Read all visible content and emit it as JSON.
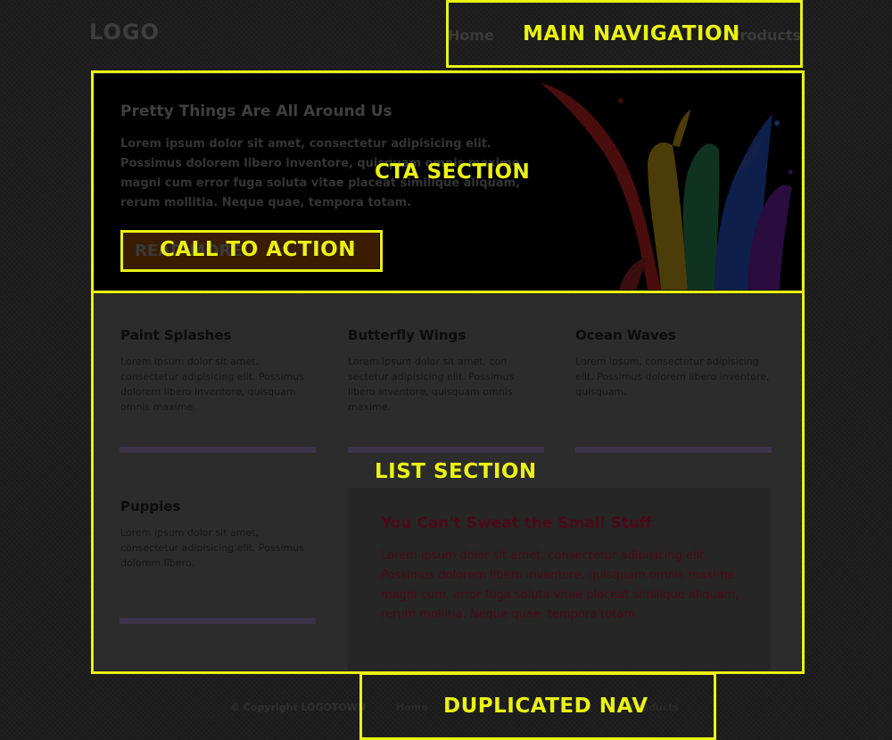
{
  "header": {
    "logo": "LOGO",
    "nav": {
      "home": "Home",
      "products": "Products"
    }
  },
  "annotations": {
    "main_navigation": "MAIN NAVIGATION",
    "cta_section": "CTA SECTION",
    "call_to_action": "CALL TO ACTION",
    "list_section": "LIST SECTION",
    "duplicated_nav": "DUPLICATED NAV"
  },
  "cta": {
    "title": "Pretty Things Are All Around Us",
    "text": "Lorem ipsum dolor sit amet, consectetur adipisicing elit. Possimus dolorem libero inventore, quisquam omnis maxime magni cum error fuga soluta vitae placeat similique aliquam, rerum mollitia. Neque quae, tempora totam.",
    "button": "READ MORE"
  },
  "list": {
    "cards": [
      {
        "title": "Paint Splashes",
        "text": "Lorem ipsum dolor sit amet, consectetur adipisicing elit. Possimus dolorem libero inventore, quisquam omnis maxime."
      },
      {
        "title": "Butterfly Wings",
        "text": "Lorem ipsum dolor sit amet, con sectetur adipisicing elit. Possimus libero inventore, quisquam omnis maxime."
      },
      {
        "title": "Ocean Waves",
        "text": "Lorem ipsum, consectetur adipisicing elit. Possimus dolorem libero inventore, quisquam."
      },
      {
        "title": "Puppies",
        "text": "Lorem ipsum dolor sit amet, consectetur adipisicing elit. Possimus dolorem libero."
      }
    ],
    "feature": {
      "title": "You Can't Sweat the Small Stuff",
      "text": "Lorem ipsum dolor sit amet, consectetur adipisicing elit. Possimus dolorem libero inventore, quisquam omnis maxime magni cum, error fuga soluta vitae placeat similique aliquam, rerum mollitia. Neque quae, tempora totam."
    }
  },
  "footer": {
    "copyright": "© Copyright LOGOTOWN",
    "nav": {
      "home": "Home",
      "products": "Products"
    }
  },
  "colors": {
    "highlight": "#eaf212",
    "background": "#1b1b1b"
  }
}
